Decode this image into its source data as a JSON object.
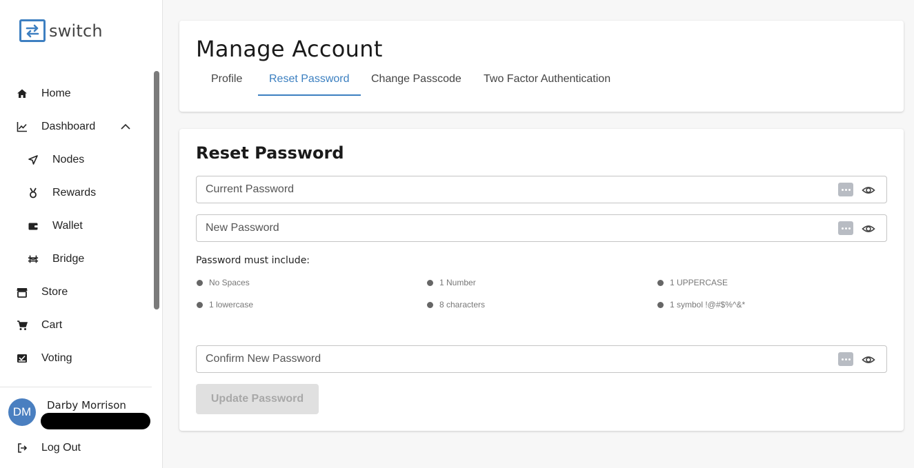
{
  "brand": {
    "name": "switch",
    "color": "#3d7fc1"
  },
  "sidebar": {
    "items": [
      {
        "label": "Home",
        "icon": "home-icon"
      },
      {
        "label": "Dashboard",
        "icon": "chart-line-icon",
        "expanded": true
      },
      {
        "label": "Nodes",
        "icon": "send-icon"
      },
      {
        "label": "Rewards",
        "icon": "medal-icon"
      },
      {
        "label": "Wallet",
        "icon": "wallet-icon"
      },
      {
        "label": "Bridge",
        "icon": "bridge-icon"
      },
      {
        "label": "Store",
        "icon": "store-icon"
      },
      {
        "label": "Cart",
        "icon": "cart-icon"
      },
      {
        "label": "Voting",
        "icon": "ballot-icon"
      }
    ],
    "user": {
      "initials": "DM",
      "name": "Darby Morrison"
    },
    "logout_label": "Log Out"
  },
  "header": {
    "title": "Manage Account",
    "tabs": [
      {
        "label": "Profile"
      },
      {
        "label": "Reset Password",
        "active": true
      },
      {
        "label": "Change Passcode"
      },
      {
        "label": "Two Factor Authentication"
      }
    ]
  },
  "reset": {
    "title": "Reset Password",
    "current_placeholder": "Current Password",
    "new_placeholder": "New Password",
    "confirm_placeholder": "Confirm New Password",
    "rules_title": "Password must include:",
    "rules": [
      "No Spaces",
      "1 Number",
      "1 UPPERCASE",
      "1 lowercase",
      "8 characters",
      "1 symbol !@#$%^&*"
    ],
    "button_label": "Update Password"
  }
}
